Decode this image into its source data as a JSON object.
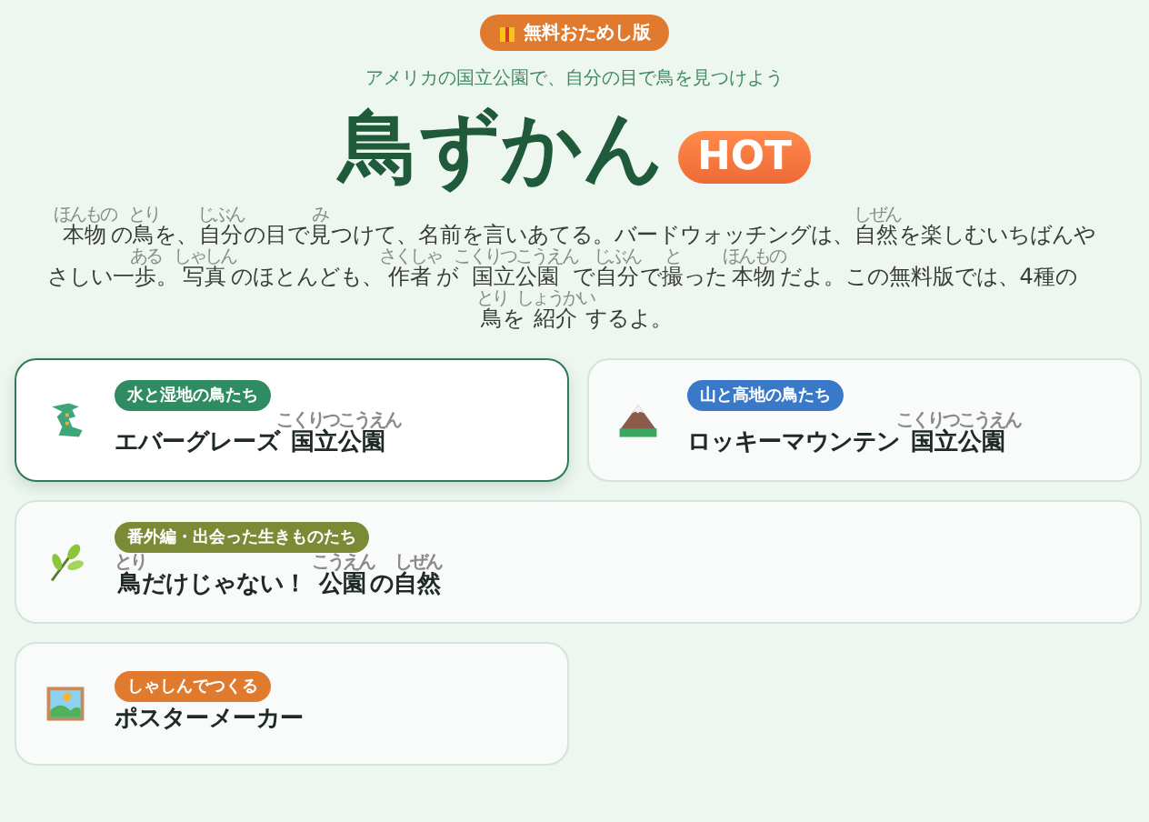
{
  "badge": {
    "label": "無料おためし版"
  },
  "subtitle": "アメリカの国立公園で、自分の目で鳥を見つけよう",
  "title": "鳥ずかん",
  "hot_badge": "HOT",
  "intro": [
    {
      "b": "本物",
      "r": "ほんもの"
    },
    "の",
    {
      "b": "鳥",
      "r": "とり"
    },
    "を、",
    {
      "b": "自分",
      "r": "じぶん"
    },
    "の目で",
    {
      "b": "見",
      "r": "み"
    },
    "つけて、名前を言いあてる。バードウォッチングは、",
    {
      "b": "自然",
      "r": "しぜん"
    },
    "を楽しむいちばんやさしい一",
    {
      "b": "歩",
      "r": "ある"
    },
    "。",
    {
      "b": "写真",
      "r": "しゃしん"
    },
    "のほとんども、",
    {
      "b": "作者",
      "r": "さくしゃ"
    },
    "が",
    {
      "b": "国立公園",
      "r": "こくりつこうえん"
    },
    "で",
    {
      "b": "自分",
      "r": "じぶん"
    },
    "で",
    {
      "b": "撮",
      "r": "と"
    },
    "った",
    {
      "b": "本物",
      "r": "ほんもの"
    },
    "だよ。この無料版では、4種の",
    {
      "b": "鳥",
      "r": "とり"
    },
    "を",
    {
      "b": "紹介",
      "r": "しょうかい"
    },
    "するよ。"
  ],
  "cards": [
    {
      "tag": "水と湿地の鳥たち",
      "color": "#2e8b62",
      "title": [
        "エバーグレーズ",
        {
          "b": "国立公園",
          "r": "こくりつこうえん"
        }
      ],
      "selected": true,
      "wide": false
    },
    {
      "tag": "山と高地の鳥たち",
      "color": "#3a78c8",
      "title": [
        "ロッキーマウンテン",
        {
          "b": "国立公園",
          "r": "こくりつこうえん"
        }
      ],
      "selected": false,
      "wide": false
    },
    {
      "tag": "番外編・出会った生きものたち",
      "color": "#7b8a35",
      "title": [
        {
          "b": "鳥",
          "r": "とり"
        },
        "だけじゃない！ ",
        {
          "b": "公園",
          "r": "こうえん"
        },
        "の",
        {
          "b": "自然",
          "r": "しぜん"
        }
      ],
      "selected": false,
      "wide": true
    },
    {
      "tag": "しゃしんでつくる",
      "color": "#e07a2e",
      "title": [
        "ポスターメーカー"
      ],
      "selected": false,
      "wide": false
    }
  ]
}
